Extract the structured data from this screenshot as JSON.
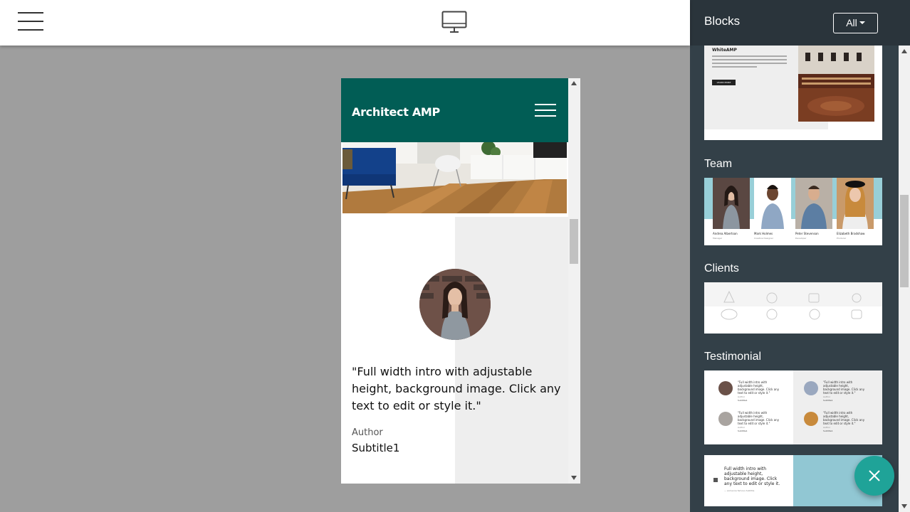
{
  "sidebar": {
    "title": "Blocks",
    "filter_label": "All",
    "sections": [
      {
        "label": "Team"
      },
      {
        "label": "Clients"
      },
      {
        "label": "Testimonial"
      }
    ],
    "whiteamp_card": {
      "title": "WhiteAMP",
      "button": "LEARN MORE"
    },
    "team_card": {
      "members": [
        {
          "name": "Andrea Albertson",
          "role": "Manager"
        },
        {
          "name": "Mark Holmes",
          "role": "Creative Designer"
        },
        {
          "name": "Peter Stevenson",
          "role": "Developer"
        },
        {
          "name": "Elizabeth Bradshaw",
          "role": "Producer"
        }
      ]
    },
    "testimonial_card": {
      "quote": "\"Full width intro with adjustable height, background image. Click any text to edit or style it.\"",
      "author": "Author",
      "subtitle": "Subtitle1"
    },
    "intro_card": {
      "text": "Full width intro with adjustable height, background image. Click any text to edit or style it.",
      "caption": "— someone famous  Subtitle"
    }
  },
  "preview": {
    "brand": "Architect AMP",
    "quote": "\"Full width intro with adjustable height, background image. Click any text to edit or style it.\"",
    "author": "Author",
    "subtitle": "Subtitle1"
  },
  "colors": {
    "nav_bg": "#015d55",
    "sidebar_bg": "#334048",
    "fab": "#1fa398"
  }
}
